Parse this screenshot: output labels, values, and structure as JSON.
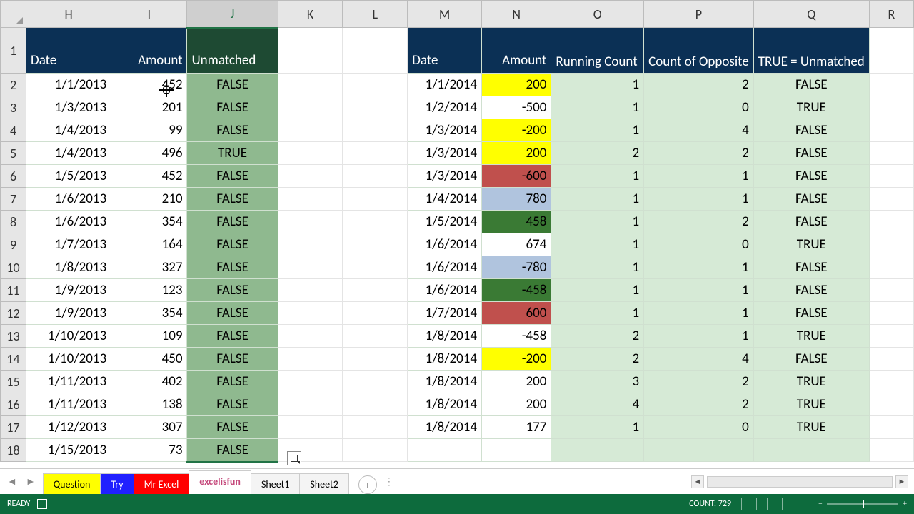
{
  "cols": {
    "H": "H",
    "I": "I",
    "J": "J",
    "K": "K",
    "L": "L",
    "M": "M",
    "N": "N",
    "O": "O",
    "P": "P",
    "Q": "Q",
    "R": "R"
  },
  "rowNums": [
    "1",
    "2",
    "3",
    "4",
    "5",
    "6",
    "7",
    "8",
    "9",
    "10",
    "11",
    "12",
    "13",
    "14",
    "15",
    "16",
    "17",
    "18"
  ],
  "left_headers": {
    "date": "Date",
    "amount": "Amount",
    "unmatched": "Unmatched"
  },
  "right_headers": {
    "date": "Date",
    "amount": "Amount",
    "running": "Running Count",
    "opposite": "Count of Opposite",
    "unmatched": "TRUE = Unmatched"
  },
  "left": [
    {
      "date": "1/1/2013",
      "amount": "452",
      "un": "FALSE"
    },
    {
      "date": "1/3/2013",
      "amount": "201",
      "un": "FALSE"
    },
    {
      "date": "1/4/2013",
      "amount": "99",
      "un": "FALSE"
    },
    {
      "date": "1/4/2013",
      "amount": "496",
      "un": "TRUE"
    },
    {
      "date": "1/5/2013",
      "amount": "452",
      "un": "FALSE"
    },
    {
      "date": "1/6/2013",
      "amount": "210",
      "un": "FALSE"
    },
    {
      "date": "1/6/2013",
      "amount": "354",
      "un": "FALSE"
    },
    {
      "date": "1/7/2013",
      "amount": "164",
      "un": "FALSE"
    },
    {
      "date": "1/8/2013",
      "amount": "327",
      "un": "FALSE"
    },
    {
      "date": "1/9/2013",
      "amount": "123",
      "un": "FALSE"
    },
    {
      "date": "1/9/2013",
      "amount": "354",
      "un": "FALSE"
    },
    {
      "date": "1/10/2013",
      "amount": "109",
      "un": "FALSE"
    },
    {
      "date": "1/10/2013",
      "amount": "450",
      "un": "FALSE"
    },
    {
      "date": "1/11/2013",
      "amount": "402",
      "un": "FALSE"
    },
    {
      "date": "1/11/2013",
      "amount": "138",
      "un": "FALSE"
    },
    {
      "date": "1/12/2013",
      "amount": "307",
      "un": "FALSE"
    },
    {
      "date": "1/15/2013",
      "amount": "73",
      "un": "FALSE"
    }
  ],
  "right": [
    {
      "date": "1/1/2014",
      "amount": "200",
      "rc": "1",
      "co": "2",
      "un": "FALSE",
      "hl": "yellow"
    },
    {
      "date": "1/2/2014",
      "amount": "-500",
      "rc": "1",
      "co": "0",
      "un": "TRUE",
      "hl": ""
    },
    {
      "date": "1/3/2014",
      "amount": "-200",
      "rc": "1",
      "co": "4",
      "un": "FALSE",
      "hl": "yellow"
    },
    {
      "date": "1/3/2014",
      "amount": "200",
      "rc": "2",
      "co": "2",
      "un": "FALSE",
      "hl": "yellow"
    },
    {
      "date": "1/3/2014",
      "amount": "-600",
      "rc": "1",
      "co": "1",
      "un": "FALSE",
      "hl": "brick"
    },
    {
      "date": "1/4/2014",
      "amount": "780",
      "rc": "1",
      "co": "1",
      "un": "FALSE",
      "hl": "blue"
    },
    {
      "date": "1/5/2014",
      "amount": "458",
      "rc": "1",
      "co": "2",
      "un": "FALSE",
      "hl": "dgreen"
    },
    {
      "date": "1/6/2014",
      "amount": "674",
      "rc": "1",
      "co": "0",
      "un": "TRUE",
      "hl": ""
    },
    {
      "date": "1/6/2014",
      "amount": "-780",
      "rc": "1",
      "co": "1",
      "un": "FALSE",
      "hl": "blue"
    },
    {
      "date": "1/6/2014",
      "amount": "-458",
      "rc": "1",
      "co": "1",
      "un": "FALSE",
      "hl": "dgreen"
    },
    {
      "date": "1/7/2014",
      "amount": "600",
      "rc": "1",
      "co": "1",
      "un": "FALSE",
      "hl": "brick"
    },
    {
      "date": "1/8/2014",
      "amount": "-458",
      "rc": "2",
      "co": "1",
      "un": "TRUE",
      "hl": ""
    },
    {
      "date": "1/8/2014",
      "amount": "-200",
      "rc": "2",
      "co": "4",
      "un": "FALSE",
      "hl": "yellow"
    },
    {
      "date": "1/8/2014",
      "amount": "200",
      "rc": "3",
      "co": "2",
      "un": "TRUE",
      "hl": ""
    },
    {
      "date": "1/8/2014",
      "amount": "200",
      "rc": "4",
      "co": "2",
      "un": "TRUE",
      "hl": ""
    },
    {
      "date": "1/8/2014",
      "amount": "177",
      "rc": "1",
      "co": "0",
      "un": "TRUE",
      "hl": ""
    }
  ],
  "tabs": {
    "q": "Question",
    "t": "Try",
    "m": "Mr Excel",
    "e": "excelisfun",
    "s1": "Sheet1",
    "s2": "Sheet2",
    "new": "+"
  },
  "status": {
    "ready": "READY",
    "count_label": "COUNT:",
    "count_val": "729",
    "zoom": "100%",
    "plus": "+",
    "minus": "−"
  },
  "tabnav": {
    "prev": "◄",
    "next": "►",
    "dots": "⋮"
  },
  "scroll": {
    "left": "◄",
    "right": "►"
  }
}
